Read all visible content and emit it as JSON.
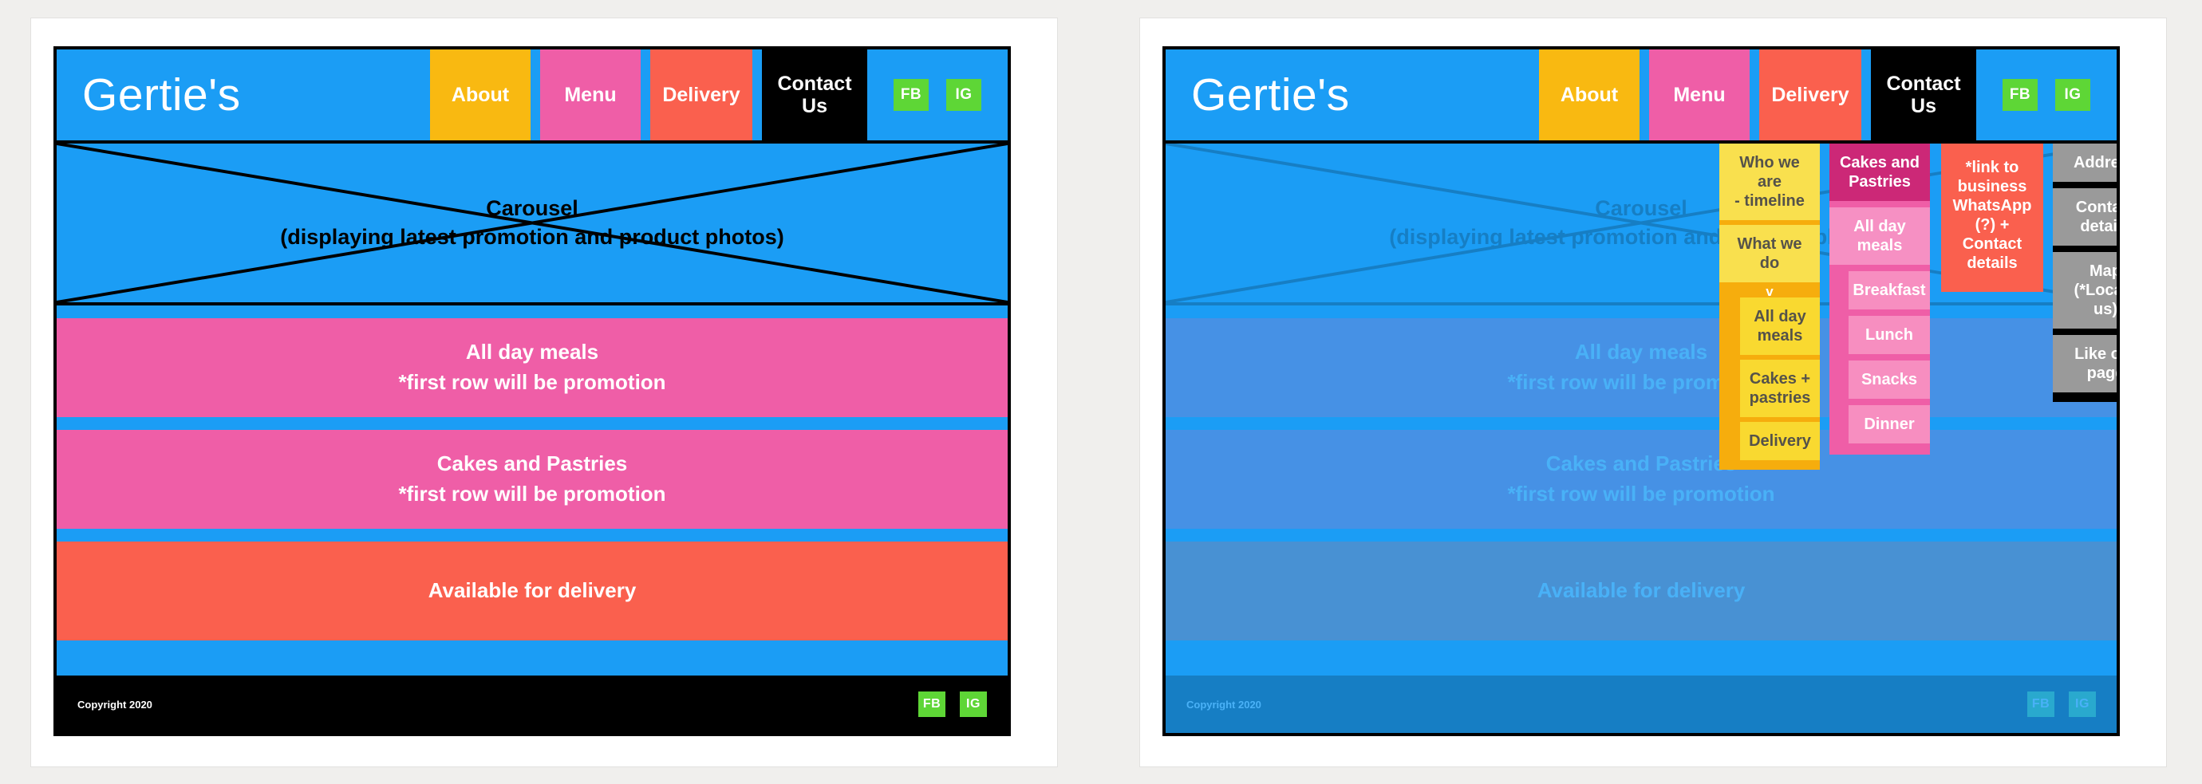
{
  "page": {
    "background_color": "#f0efed",
    "panel_count": 2
  },
  "site": {
    "brand": "Gertie's",
    "colors": {
      "blue": "#1b9df5",
      "yellow": "#f9b911",
      "pink": "#ef5ea7",
      "coral": "#fa604e",
      "black": "#000000",
      "green": "#5ed636",
      "gray": "#9a9a9a"
    },
    "nav": [
      {
        "label": "About",
        "color": "#f9b911"
      },
      {
        "label": "Menu",
        "color": "#ef5ea7"
      },
      {
        "label": "Delivery",
        "color": "#fa604e"
      },
      {
        "label": "Contact\nUs",
        "color": "#000000"
      }
    ],
    "nav_labels": {
      "about": "About",
      "menu": "Menu",
      "delivery": "Delivery",
      "contact_line1": "Contact",
      "contact_line2": "Us"
    },
    "social": {
      "facebook": "FB",
      "instagram": "IG"
    },
    "carousel": {
      "title": "Carousel",
      "subtitle": "(displaying latest promotion and product photos)"
    },
    "sections": [
      {
        "title": "All day meals",
        "note": "*first row will be promotion",
        "color": "#ef5ea7"
      },
      {
        "title": "Cakes and Pastries",
        "note": "*first row will be promotion",
        "color": "#ef5ea7"
      },
      {
        "title": "Available for delivery",
        "note": "",
        "color": "#fa604e"
      }
    ],
    "footer": {
      "copyright": "Copyright 2020",
      "facebook": "FB",
      "instagram": "IG"
    }
  },
  "dropdowns": {
    "about": {
      "parent": "About",
      "items": [
        {
          "label": "Who we\nare\n- timeline",
          "sub": false
        },
        {
          "label": "What we\ndo",
          "sub": false
        },
        {
          "label": "All day\nmeals",
          "sub": true
        },
        {
          "label": "Cakes +\npastries",
          "sub": true
        },
        {
          "label": "Delivery",
          "sub": true
        }
      ],
      "caret": "v"
    },
    "menu": {
      "parent": "Menu",
      "items": [
        {
          "label": "Cakes and\nPastries",
          "style": "dark",
          "sub": false
        },
        {
          "label": "All day\nmeals",
          "style": "light",
          "sub": false
        },
        {
          "label": "Breakfast",
          "style": "light",
          "sub": true
        },
        {
          "label": "Lunch",
          "style": "light",
          "sub": true
        },
        {
          "label": "Snacks",
          "style": "light",
          "sub": true
        },
        {
          "label": "Dinner",
          "style": "light",
          "sub": true
        }
      ]
    },
    "delivery": {
      "parent": "Delivery",
      "items": [
        {
          "label": "*link to\nbusiness\nWhatsApp\n(?) +\nContact\ndetails"
        }
      ]
    },
    "contact": {
      "parent": "Contact Us",
      "items": [
        {
          "label": "Address"
        },
        {
          "label": "Contact\ndetails"
        },
        {
          "label": "Map\n(*Locate\nus)"
        },
        {
          "label": "Like our\npage"
        }
      ]
    }
  }
}
